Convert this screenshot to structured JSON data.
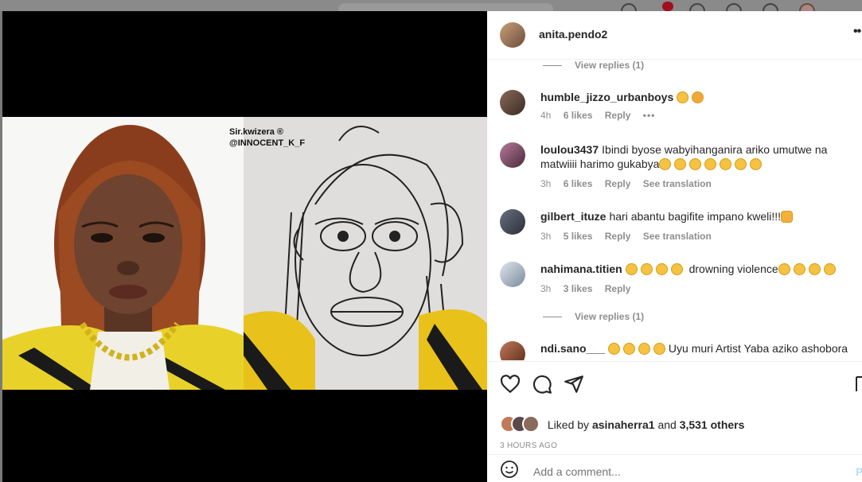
{
  "post": {
    "author": "anita.pendo2",
    "more_icon": "more-horizontal-icon",
    "watermark_line1": "Sir.kwizera ®",
    "watermark_line2": "@INNOCENT_K_F"
  },
  "comments": {
    "view_replies_top": "View replies (1)",
    "view_replies_bottom": "View replies (1)",
    "items": [
      {
        "user": "humble_jizzo_urbanboys",
        "text": "",
        "time": "4h",
        "likes": "6 likes",
        "reply": "Reply",
        "translate": ""
      },
      {
        "user": "loulou3437",
        "text": "Ibindi byose wabyihanganira ariko umutwe na matwiiii harimo gukabya",
        "time": "3h",
        "likes": "6 likes",
        "reply": "Reply",
        "translate": "See translation"
      },
      {
        "user": "gilbert_ituze",
        "text": "hari abantu bagifite impano kweli!!!",
        "time": "3h",
        "likes": "5 likes",
        "reply": "Reply",
        "translate": "See translation"
      },
      {
        "user": "nahimana.titien",
        "text": "drowning violence",
        "time": "3h",
        "likes": "3 likes",
        "reply": "Reply",
        "translate": ""
      },
      {
        "user": "ndi.sano___",
        "text": "Uyu muri Artist Yaba aziko ashobora",
        "time": "",
        "likes": "",
        "reply": "",
        "translate": ""
      }
    ]
  },
  "actions": {
    "like_icon": "heart-icon",
    "comment_icon": "comment-icon",
    "share_icon": "paper-plane-icon",
    "save_icon": "bookmark-icon",
    "liked_by_prefix": "Liked by",
    "liked_by_user": "asinaherra1",
    "liked_by_and": "and",
    "liked_by_others": "3,531 others",
    "timestamp": "3 HOURS AGO"
  },
  "add_comment": {
    "placeholder": "Add a comment...",
    "post_label": "Po",
    "emoji_icon": "smiley-icon"
  },
  "colors": {
    "link": "#0095f6",
    "muted": "#8e8e8e",
    "text": "#262626"
  }
}
